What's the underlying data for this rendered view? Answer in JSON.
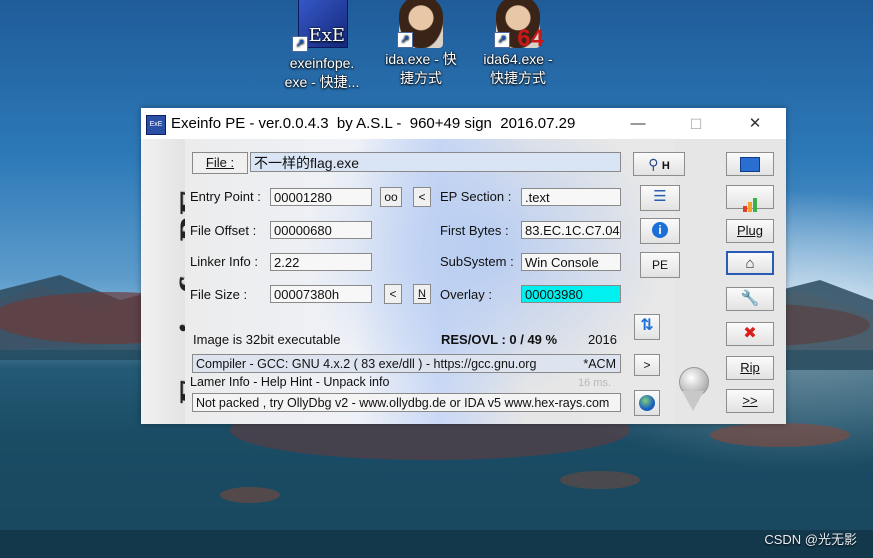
{
  "desktop": {
    "icons": [
      {
        "line1": "exeinfope.",
        "line2": "exe - 快捷...",
        "badge": "ExE"
      },
      {
        "line1": "ida.exe - 快",
        "line2": "捷方式",
        "badge": ""
      },
      {
        "line1": "ida64.exe -",
        "line2": "快捷方式",
        "badge": "64"
      }
    ],
    "watermark": "CSDN @光无影"
  },
  "window": {
    "title": "Exeinfo PE - ver.0.0.4.3  by A.S.L -  960+49 sign  2016.07.29",
    "controls": {
      "minimize": "—",
      "maximize": "☐",
      "close": "✕"
    },
    "app_icon_text": "ExE"
  },
  "logo": "Exeinfo PE",
  "file": {
    "button": "File :",
    "value": "不一样的flag.exe"
  },
  "left": {
    "entry_point": {
      "label": "Entry Point :",
      "value": "00001280",
      "btn_oo": "oo",
      "btn_lt": "<"
    },
    "file_offset": {
      "label": "File Offset :",
      "value": "00000680"
    },
    "linker_info": {
      "label": "Linker Info :",
      "value": "2.22"
    },
    "file_size": {
      "label": "File Size :",
      "value": "00007380h",
      "btn_lt": "<",
      "btn_n": "N"
    }
  },
  "right": {
    "ep_section": {
      "label": "EP Section :",
      "value": ".text"
    },
    "first_bytes": {
      "label": "First Bytes :",
      "value": "83.EC.1C.C7.04"
    },
    "subsystem": {
      "label": "SubSystem :",
      "value": "Win Console"
    },
    "overlay": {
      "label": "Overlay :",
      "value": "00003980"
    }
  },
  "status": {
    "image": "Image is 32bit executable",
    "res_ovl": "RES/OVL : 0 / 49 %",
    "year": "2016"
  },
  "compiler": {
    "text": "Compiler - GCC: GNU 4.x.2 ( 83 exe/dll ) - https://gcc.gnu.org",
    "tag": "*ACM"
  },
  "lamer": {
    "text": "Lamer Info - Help Hint - Unpack info",
    "time": "16 ms."
  },
  "packed": {
    "text": "Not packed , try OllyDbg v2 - www.ollydbg.de or IDA v5 www.hex-rays.com"
  },
  "middle_buttons": {
    "search_h": "H",
    "pe": "PE",
    "arrow": ">"
  },
  "right_buttons": {
    "plug": "Plug",
    "rip": "Rip",
    "next": ">>"
  },
  "colors": {
    "overlay_bg": "#00f0f0",
    "file_field_bg": "#d9e4f5"
  }
}
